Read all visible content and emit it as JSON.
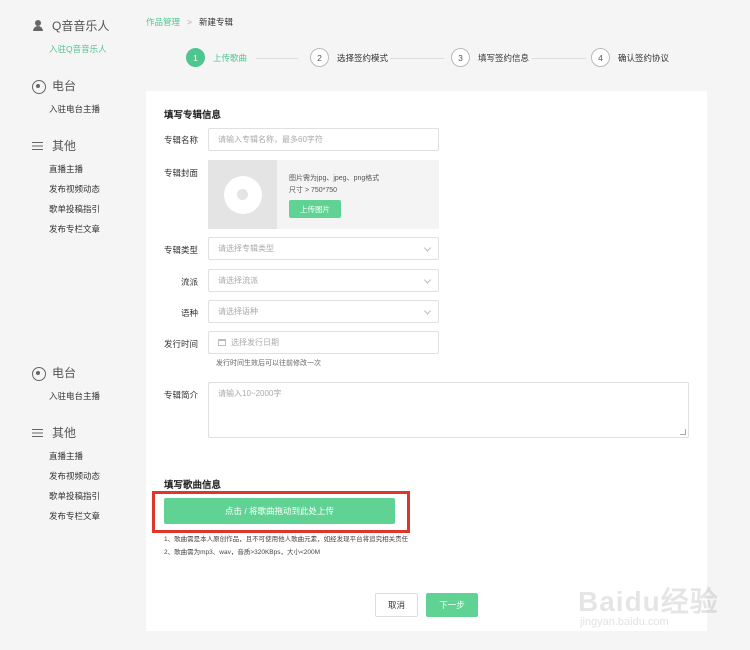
{
  "sidebar": {
    "sections": [
      {
        "icon": "person-icon",
        "title": "Q音音乐人",
        "items": [
          {
            "label": "入驻Q音音乐人",
            "active": true
          }
        ]
      },
      {
        "icon": "radio-icon",
        "title": "电台",
        "items": [
          {
            "label": "入驻电台主播"
          }
        ]
      },
      {
        "icon": "menu-icon",
        "title": "其他",
        "items": [
          {
            "label": "直播主播"
          },
          {
            "label": "发布视频动态"
          },
          {
            "label": "歌单投稿指引"
          },
          {
            "label": "发布专栏文章"
          }
        ]
      },
      {
        "icon": "radio-icon",
        "title": "电台",
        "items": [
          {
            "label": "入驻电台主播"
          }
        ]
      },
      {
        "icon": "menu-icon",
        "title": "其他",
        "items": [
          {
            "label": "直播主播"
          },
          {
            "label": "发布视频动态"
          },
          {
            "label": "歌单投稿指引"
          },
          {
            "label": "发布专栏文章"
          }
        ]
      }
    ]
  },
  "breadcrumb": {
    "parent": "作品管理",
    "separator": ">",
    "current": "新建专辑"
  },
  "steps": [
    {
      "num": "1",
      "label": "上传歌曲",
      "active": true
    },
    {
      "num": "2",
      "label": "选择签约模式"
    },
    {
      "num": "3",
      "label": "填写签约信息"
    },
    {
      "num": "4",
      "label": "确认签约协议"
    }
  ],
  "album_form": {
    "title": "填写专辑信息",
    "name": {
      "label": "专辑名称",
      "placeholder": "请输入专辑名称，最多60字符"
    },
    "cover": {
      "label": "专辑封面",
      "hint1": "图片需为jpg、jpeg、png格式",
      "hint2": "尺寸 > 750*750",
      "upload_label": "上传图片"
    },
    "type": {
      "label": "专辑类型",
      "placeholder": "请选择专辑类型"
    },
    "genre": {
      "label": "流派",
      "placeholder": "请选择流派"
    },
    "language": {
      "label": "语种",
      "placeholder": "请选择语种"
    },
    "release": {
      "label": "发行时间",
      "placeholder": "选择发行日期",
      "hint": "发行时间生效后可以往前修改一次"
    },
    "intro": {
      "label": "专辑简介",
      "placeholder": "请输入10~2000字"
    }
  },
  "song_form": {
    "title": "填写歌曲信息",
    "upload_label": "点击 / 将歌曲拖动到此处上传",
    "notes": [
      "1、歌曲需是本人原创作品，且不可使用他人歌曲元素，如经发现平台将追究相关责任",
      "2、歌曲需为mp3、wav，音质>320KBps，大小<200M"
    ]
  },
  "buttons": {
    "cancel": "取消",
    "next": "下一步"
  },
  "watermark": {
    "logo": "Baidu经验",
    "url": "jingyan.baidu.com"
  },
  "colors": {
    "accent": "#60d394",
    "accent_text": "#4fc68f",
    "highlight_box": "#e0352b",
    "background": "#f5f5f5"
  }
}
